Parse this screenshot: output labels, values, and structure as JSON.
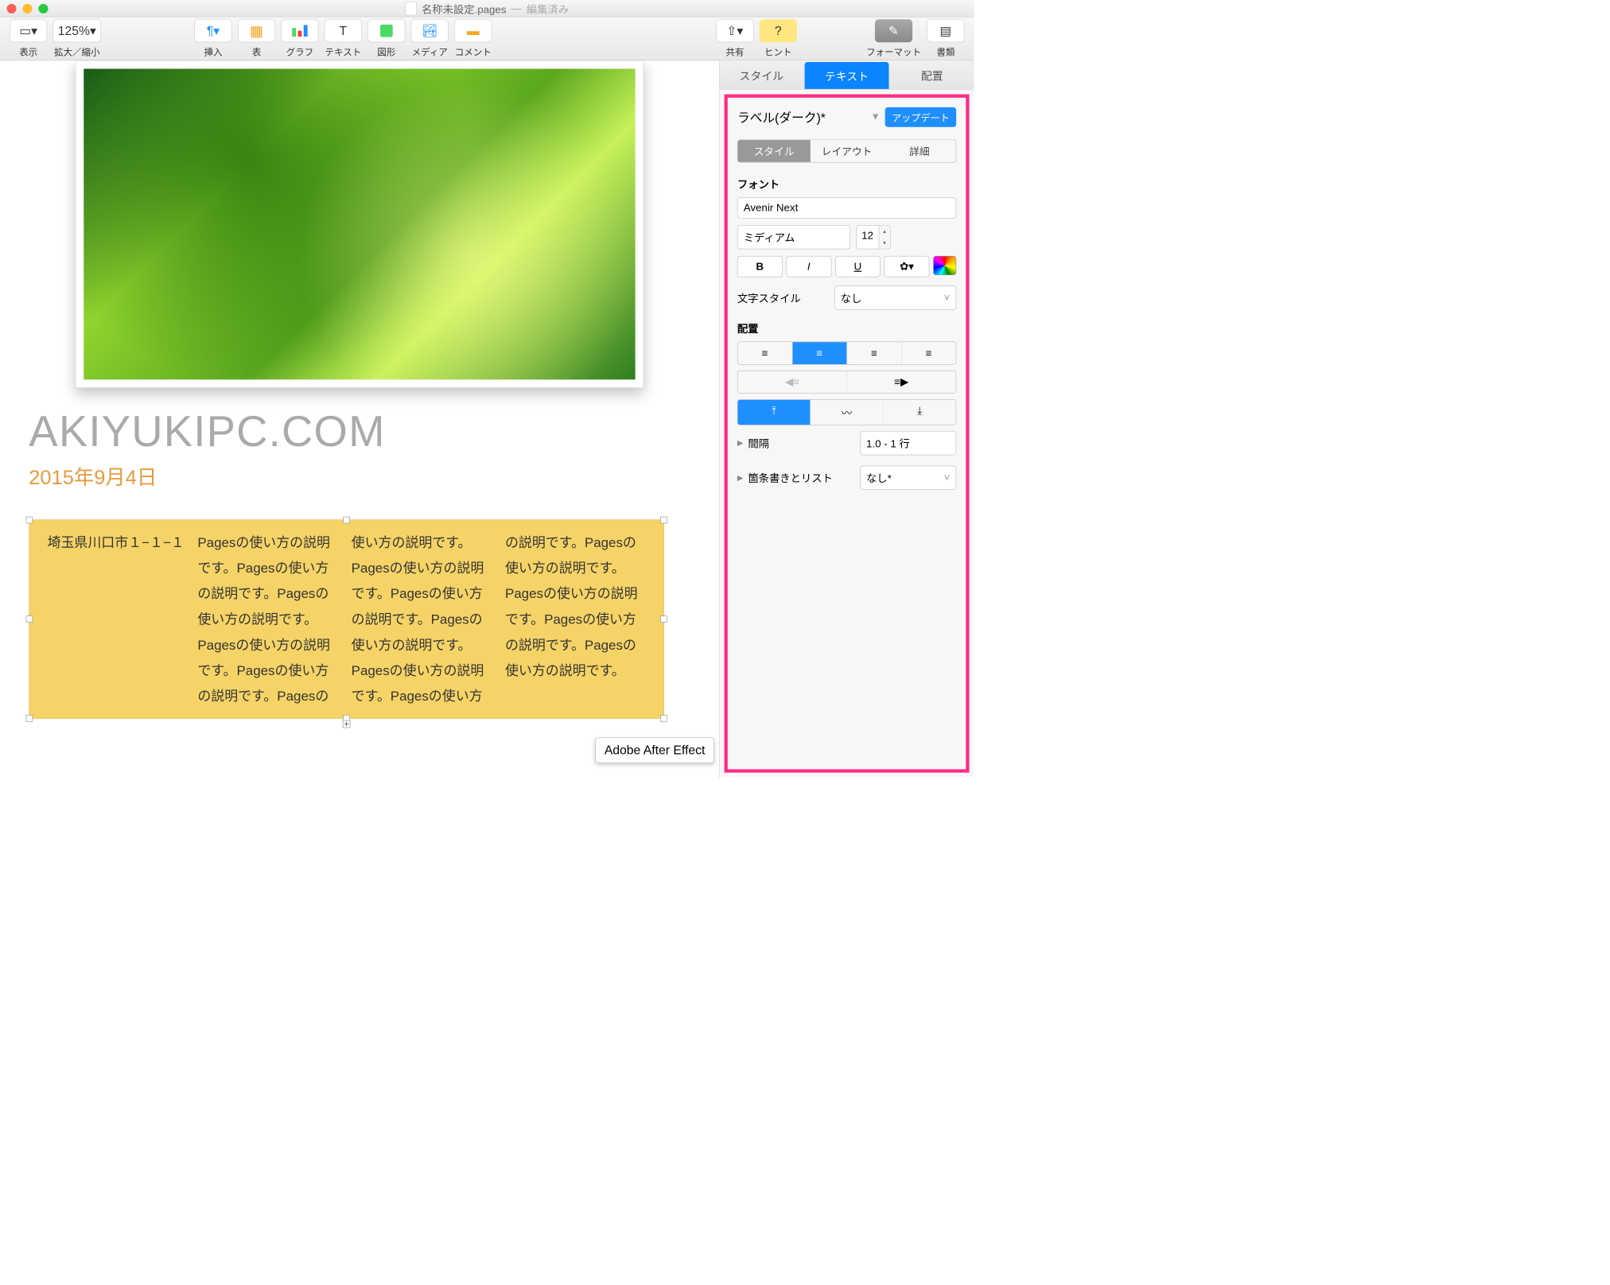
{
  "window": {
    "title": "名称未設定.pages",
    "status": "編集済み"
  },
  "toolbar": {
    "view": "表示",
    "zoom": "拡大／縮小",
    "zoom_value": "125%",
    "insert": "挿入",
    "table": "表",
    "chart": "グラフ",
    "text": "テキスト",
    "shape": "図形",
    "media": "メディア",
    "comment": "コメント",
    "share": "共有",
    "hint": "ヒント",
    "format": "フォーマット",
    "document": "書類"
  },
  "doc": {
    "heading": "AKIYUKIPC.COM",
    "date": "2015年9月4日",
    "address": "埼玉県川口市１−１−１",
    "body": "Pagesの使い方の説明です。Pagesの使い方の説明です。Pagesの使い方の説明です。Pagesの使い方の説明です。Pagesの使い方の説明です。Pagesの使い方の説明です。Pagesの使い方の説明です。Pagesの使い方の説明です。Pagesの使い方の説明です。Pagesの使い方の説明です。Pagesの使い方の説明です。Pagesの使い方の説明です。Pagesの使い方の説明です。Pagesの使い方の説明です。Pagesの使い方の説明です。"
  },
  "inspector": {
    "tabs": {
      "style": "スタイル",
      "text": "テキスト",
      "arrange": "配置"
    },
    "para_style": "ラベル(ダーク)*",
    "update_btn": "アップデート",
    "subtabs": {
      "style": "スタイル",
      "layout": "レイアウト",
      "more": "詳細"
    },
    "font_label": "フォント",
    "font_name": "Avenir Next",
    "font_weight": "ミディアム",
    "font_size": "12",
    "char_style_label": "文字スタイル",
    "char_style_value": "なし",
    "align_label": "配置",
    "spacing_label": "間隔",
    "spacing_value": "1.0 - 1 行",
    "bullets_label": "箇条書きとリスト",
    "bullets_value": "なし*"
  },
  "tooltip": "Adobe After Effect"
}
